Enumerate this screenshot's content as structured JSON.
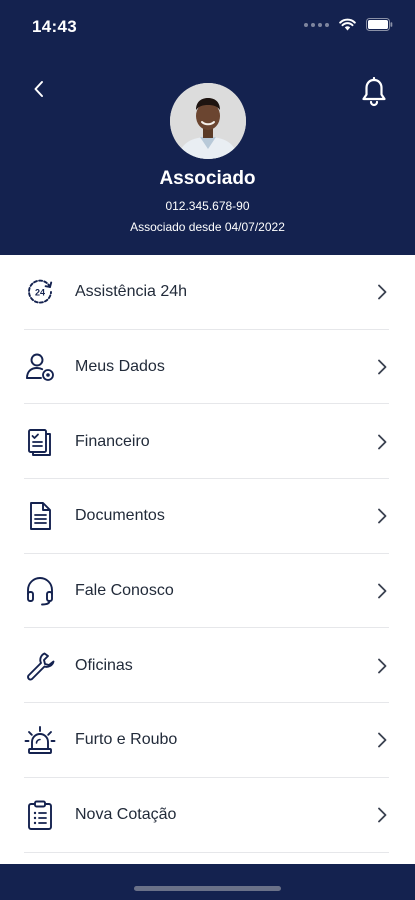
{
  "status_bar": {
    "time": "14:43"
  },
  "profile": {
    "name": "Associado",
    "document": "012.345.678-90",
    "member_since": "Associado desde 04/07/2022"
  },
  "menu": {
    "items": [
      {
        "label": "Assistência 24h",
        "icon": "assistance-24h-icon"
      },
      {
        "label": "Meus Dados",
        "icon": "user-settings-icon"
      },
      {
        "label": "Financeiro",
        "icon": "invoice-icon"
      },
      {
        "label": "Documentos",
        "icon": "document-icon"
      },
      {
        "label": "Fale Conosco",
        "icon": "headset-icon"
      },
      {
        "label": "Oficinas",
        "icon": "wrench-icon"
      },
      {
        "label": "Furto e Roubo",
        "icon": "alarm-siren-icon"
      },
      {
        "label": "Nova Cotação",
        "icon": "clipboard-icon"
      }
    ]
  },
  "colors": {
    "primary": "#14224f",
    "text": "#222b3a",
    "divider": "#e6e7ea"
  }
}
